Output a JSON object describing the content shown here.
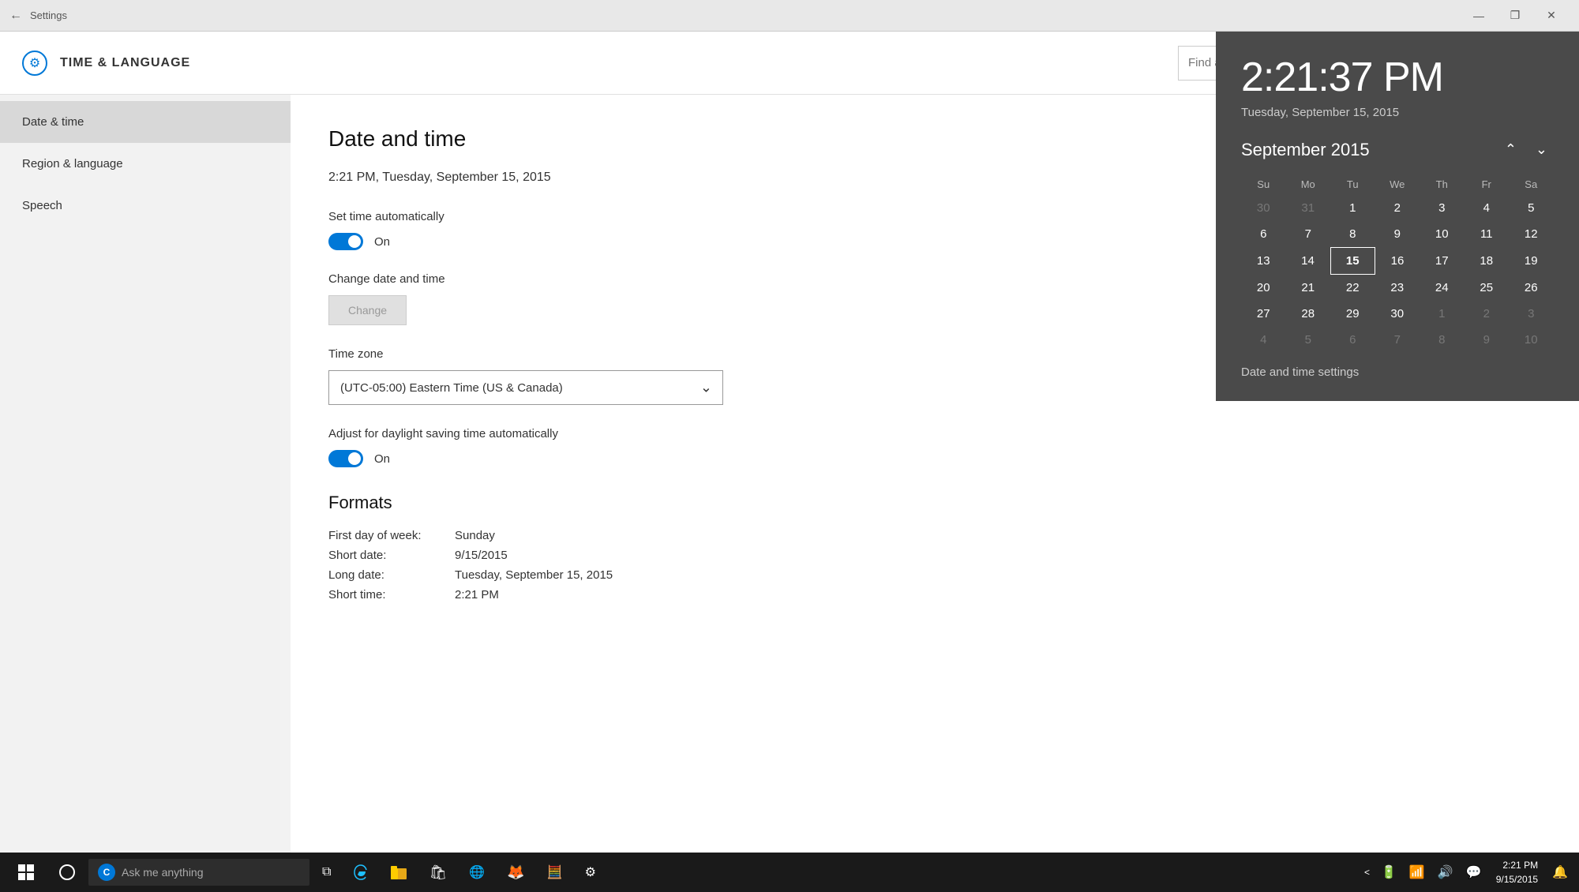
{
  "titlebar": {
    "title": "Settings",
    "minimize": "—",
    "maximize": "❐",
    "close": "✕"
  },
  "header": {
    "icon": "⚙",
    "app_title": "TIME & LANGUAGE",
    "search_placeholder": "Find a setting"
  },
  "sidebar": {
    "items": [
      {
        "id": "date-time",
        "label": "Date & time",
        "active": true
      },
      {
        "id": "region-language",
        "label": "Region & language",
        "active": false
      },
      {
        "id": "speech",
        "label": "Speech",
        "active": false
      }
    ]
  },
  "content": {
    "section_title": "Date and time",
    "current_datetime": "2:21 PM, Tuesday, September 15, 2015",
    "set_time_auto_label": "Set time automatically",
    "toggle_on_label": "On",
    "change_date_label": "Change date and time",
    "change_btn": "Change",
    "timezone_label": "Time zone",
    "timezone_value": "(UTC-05:00) Eastern Time (US & Canada)",
    "daylight_label": "Adjust for daylight saving time automatically",
    "daylight_toggle_label": "On",
    "formats_title": "Formats",
    "formats": [
      {
        "key": "First day of week:",
        "value": "Sunday"
      },
      {
        "key": "Short date:",
        "value": "9/15/2015"
      },
      {
        "key": "Long date:",
        "value": "Tuesday, September 15, 2015"
      },
      {
        "key": "Short time:",
        "value": "2:21 PM"
      }
    ]
  },
  "calendar": {
    "time": "2:21:37 PM",
    "date_full": "Tuesday, September 15, 2015",
    "month_year": "September 2015",
    "day_headers": [
      "Su",
      "Mo",
      "Tu",
      "We",
      "Th",
      "Fr",
      "Sa"
    ],
    "weeks": [
      [
        {
          "day": "30",
          "other": true
        },
        {
          "day": "31",
          "other": true
        },
        {
          "day": "1",
          "other": false
        },
        {
          "day": "2",
          "other": false
        },
        {
          "day": "3",
          "other": false
        },
        {
          "day": "4",
          "other": false
        },
        {
          "day": "5",
          "other": false
        }
      ],
      [
        {
          "day": "6",
          "other": false
        },
        {
          "day": "7",
          "other": false
        },
        {
          "day": "8",
          "other": false
        },
        {
          "day": "9",
          "other": false
        },
        {
          "day": "10",
          "other": false
        },
        {
          "day": "11",
          "other": false
        },
        {
          "day": "12",
          "other": false
        }
      ],
      [
        {
          "day": "13",
          "other": false
        },
        {
          "day": "14",
          "other": false
        },
        {
          "day": "15",
          "today": true
        },
        {
          "day": "16",
          "other": false
        },
        {
          "day": "17",
          "other": false
        },
        {
          "day": "18",
          "other": false
        },
        {
          "day": "19",
          "other": false
        }
      ],
      [
        {
          "day": "20",
          "other": false
        },
        {
          "day": "21",
          "other": false
        },
        {
          "day": "22",
          "other": false
        },
        {
          "day": "23",
          "other": false
        },
        {
          "day": "24",
          "other": false
        },
        {
          "day": "25",
          "other": false
        },
        {
          "day": "26",
          "other": false
        }
      ],
      [
        {
          "day": "27",
          "other": false
        },
        {
          "day": "28",
          "other": false
        },
        {
          "day": "29",
          "other": false
        },
        {
          "day": "30",
          "other": false
        },
        {
          "day": "1",
          "other": true
        },
        {
          "day": "2",
          "other": true
        },
        {
          "day": "3",
          "other": true
        }
      ],
      [
        {
          "day": "4",
          "other": true
        },
        {
          "day": "5",
          "other": true
        },
        {
          "day": "6",
          "other": true
        },
        {
          "day": "7",
          "other": true
        },
        {
          "day": "8",
          "other": true
        },
        {
          "day": "9",
          "other": true
        },
        {
          "day": "10",
          "other": true
        }
      ]
    ],
    "footer_link": "Date and time settings"
  },
  "taskbar": {
    "search_text": "Ask me anything",
    "clock_time": "2:21 PM",
    "clock_date": "9/15/2015"
  }
}
